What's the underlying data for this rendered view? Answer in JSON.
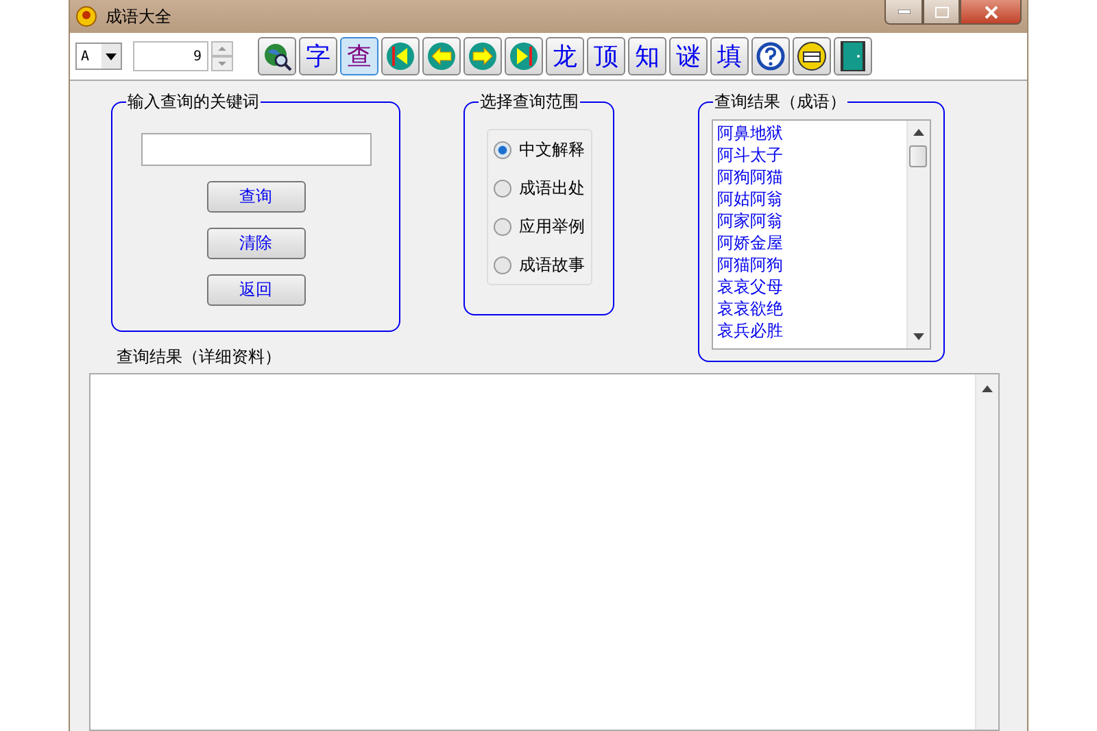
{
  "window": {
    "title": "成语大全"
  },
  "toolbar": {
    "font": "A",
    "size": "9",
    "buttons": [
      {
        "kind": "globe",
        "selected": false
      },
      {
        "kind": "char",
        "label": "字",
        "selected": false
      },
      {
        "kind": "char",
        "label": "查",
        "selected": true
      },
      {
        "kind": "first",
        "selected": false
      },
      {
        "kind": "prev",
        "selected": false
      },
      {
        "kind": "next",
        "selected": false
      },
      {
        "kind": "last",
        "selected": false
      },
      {
        "kind": "char",
        "label": "龙",
        "selected": false
      },
      {
        "kind": "char",
        "label": "顶",
        "selected": false
      },
      {
        "kind": "char",
        "label": "知",
        "selected": false
      },
      {
        "kind": "char",
        "label": "谜",
        "selected": false
      },
      {
        "kind": "char",
        "label": "填",
        "selected": false
      },
      {
        "kind": "help",
        "selected": false
      },
      {
        "kind": "print",
        "selected": false
      },
      {
        "kind": "exit",
        "selected": false
      }
    ]
  },
  "keyword_group": {
    "title": "输入查询的关键词",
    "buttons": [
      "查询",
      "清除",
      "返回"
    ]
  },
  "scope_group": {
    "title": "选择查询范围",
    "options": [
      {
        "label": "中文解释",
        "selected": true
      },
      {
        "label": "成语出处",
        "selected": false
      },
      {
        "label": "应用举例",
        "selected": false
      },
      {
        "label": "成语故事",
        "selected": false
      }
    ]
  },
  "results_group": {
    "title": "查询结果（成语）",
    "items": [
      "阿鼻地狱",
      "阿斗太子",
      "阿狗阿猫",
      "阿姑阿翁",
      "阿家阿翁",
      "阿娇金屋",
      "阿猫阿狗",
      "哀哀父母",
      "哀哀欲绝",
      "哀兵必胜"
    ]
  },
  "detail": {
    "label": "查询结果（详细资料）"
  }
}
